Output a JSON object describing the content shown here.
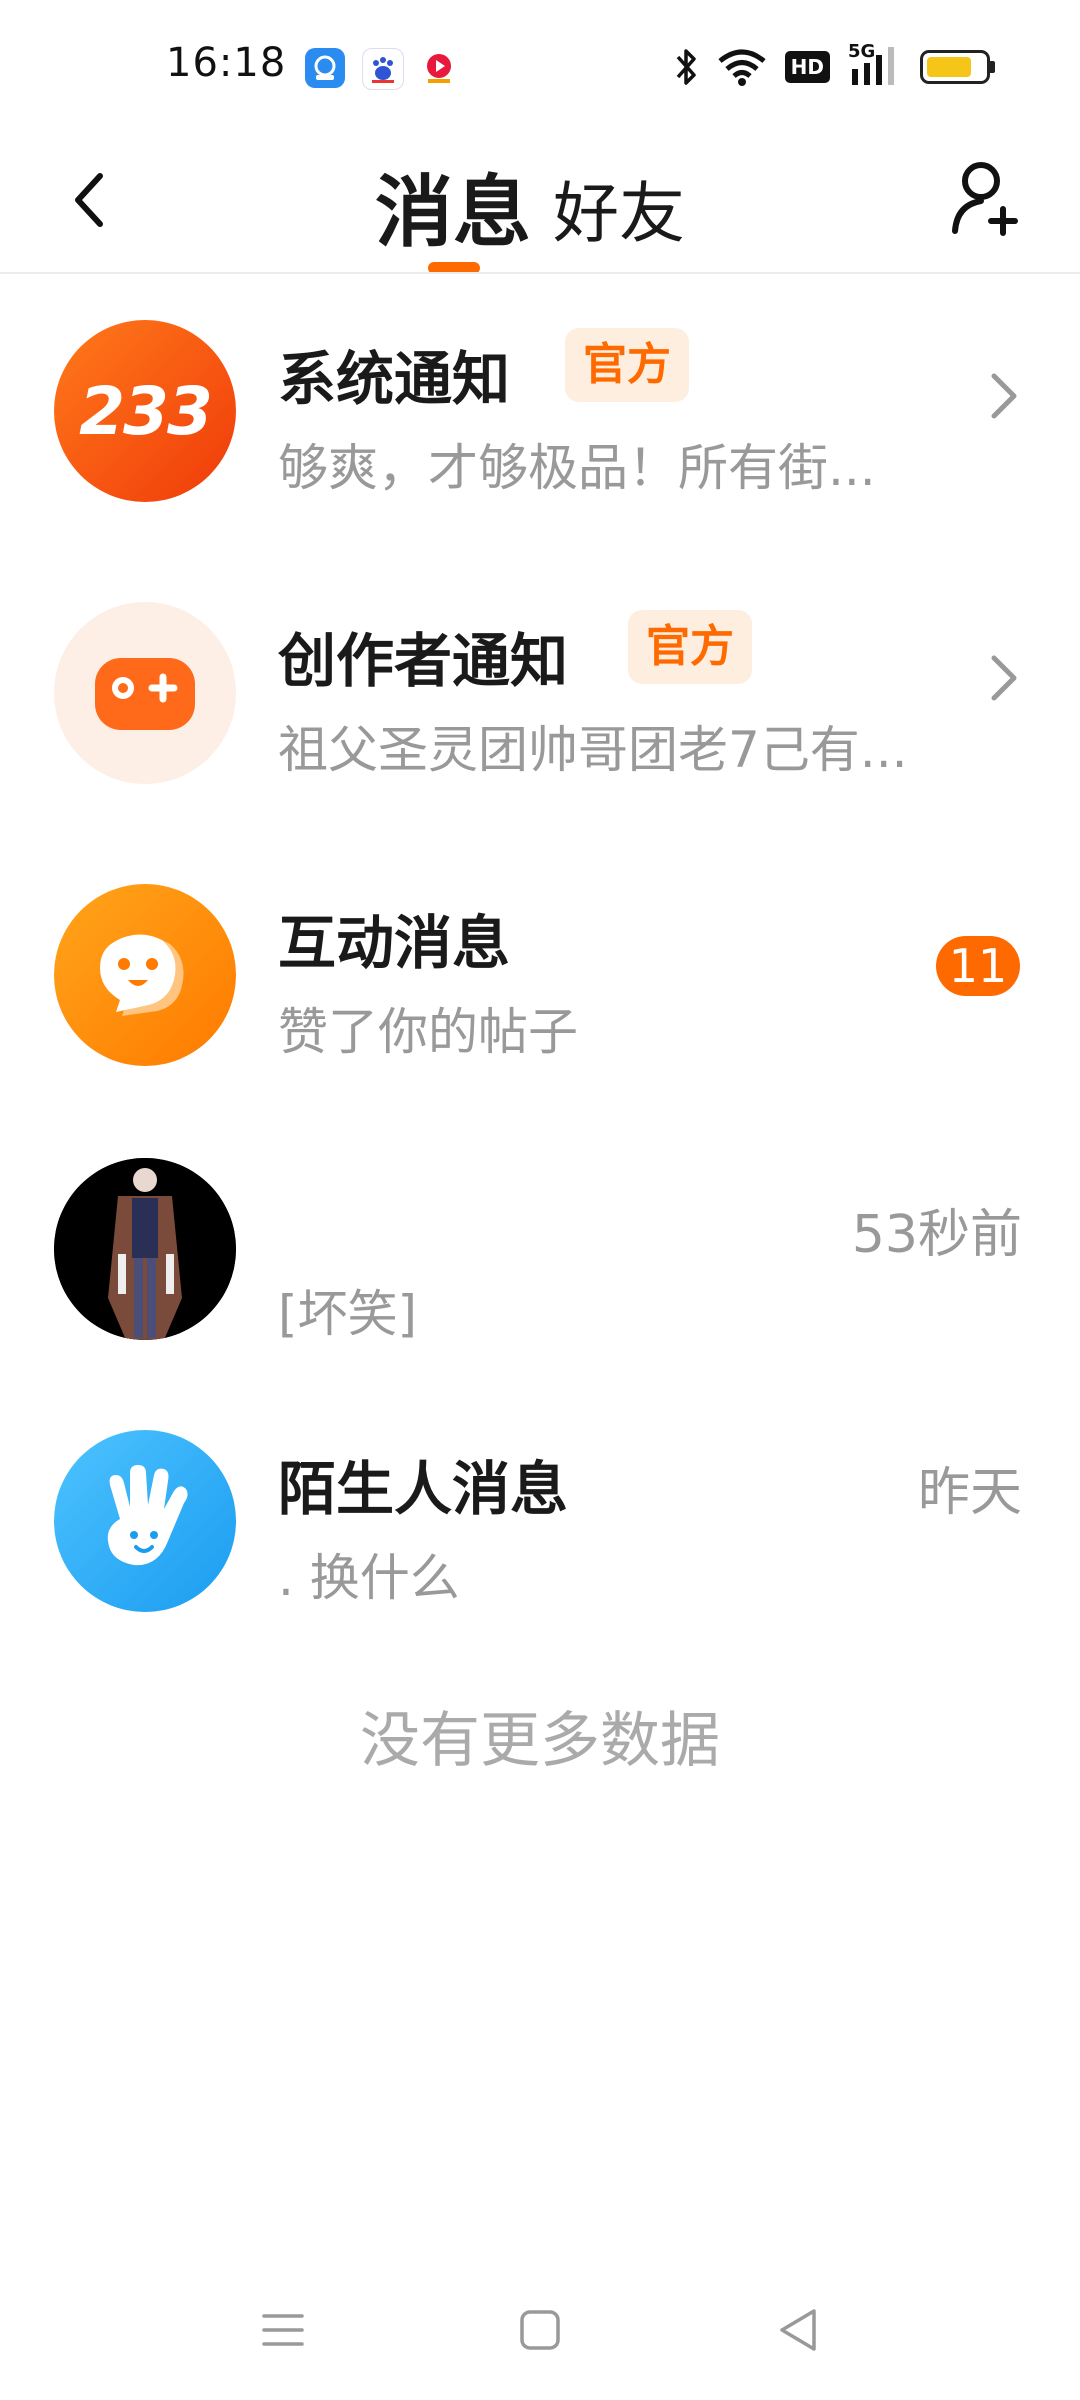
{
  "status_bar": {
    "time": "16:18",
    "network": "5G",
    "hd": "HD",
    "notification_icons": [
      "app-icon-1",
      "baidu-icon",
      "video-app-icon"
    ]
  },
  "header": {
    "tab_messages": "消息",
    "tab_friends": "好友",
    "active_tab": "消息",
    "accent_color": "#ff6a00"
  },
  "messages": [
    {
      "avatar_text": "233",
      "title": "系统通知",
      "badge": "官方",
      "preview": "够爽，才够极品！所有街...",
      "trailing": "chevron-right-icon"
    },
    {
      "title": "创作者通知",
      "badge": "官方",
      "preview": "祖父圣灵团帅哥团老7己有...",
      "trailing": "chevron-right-icon"
    },
    {
      "title": "互动消息",
      "preview": "赞了你的帖子",
      "unread_count": "11"
    },
    {
      "title": "",
      "preview": "[坏笑]",
      "timestamp": "53秒前"
    },
    {
      "title": "陌生人消息",
      "preview": ". 换什么",
      "timestamp": "昨天"
    }
  ],
  "footer": {
    "no_more": "没有更多数据"
  }
}
